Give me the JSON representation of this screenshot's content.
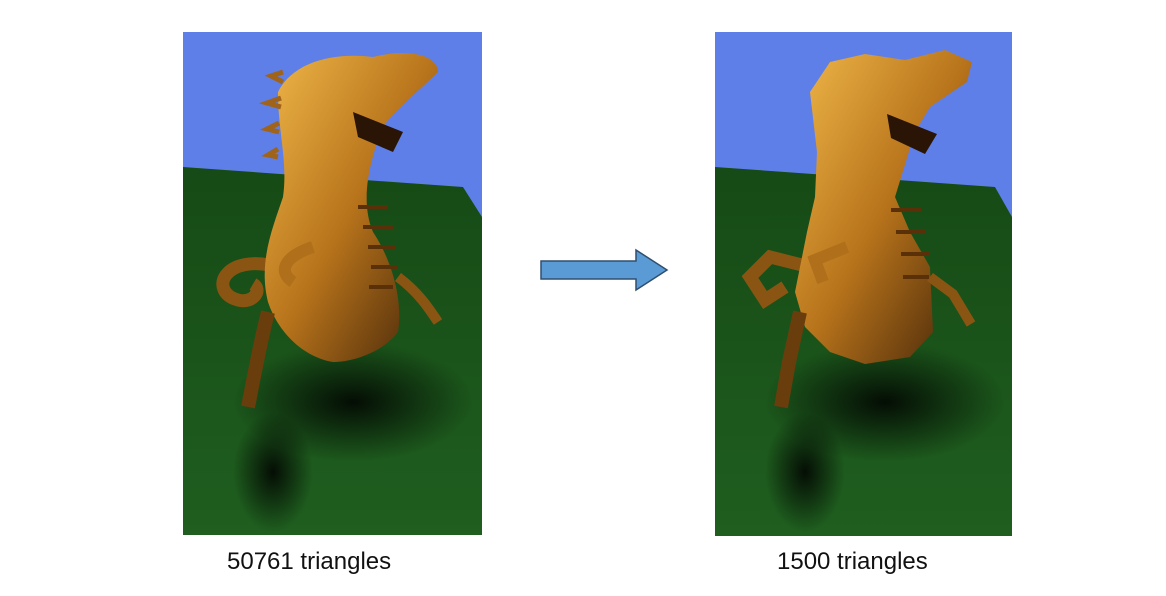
{
  "left_panel": {
    "caption": "50761 triangles",
    "description_icon": "dragon-render-high-detail"
  },
  "right_panel": {
    "caption": "1500 triangles",
    "description_icon": "dragon-render-low-detail"
  },
  "arrow": {
    "icon": "right-arrow-icon",
    "fill_color": "#5b9bd5",
    "stroke_color": "#2f4f6f"
  },
  "colors": {
    "sky": "#5f7fe8",
    "floor": "#1f5a1f",
    "dragon": "#c7861f"
  }
}
